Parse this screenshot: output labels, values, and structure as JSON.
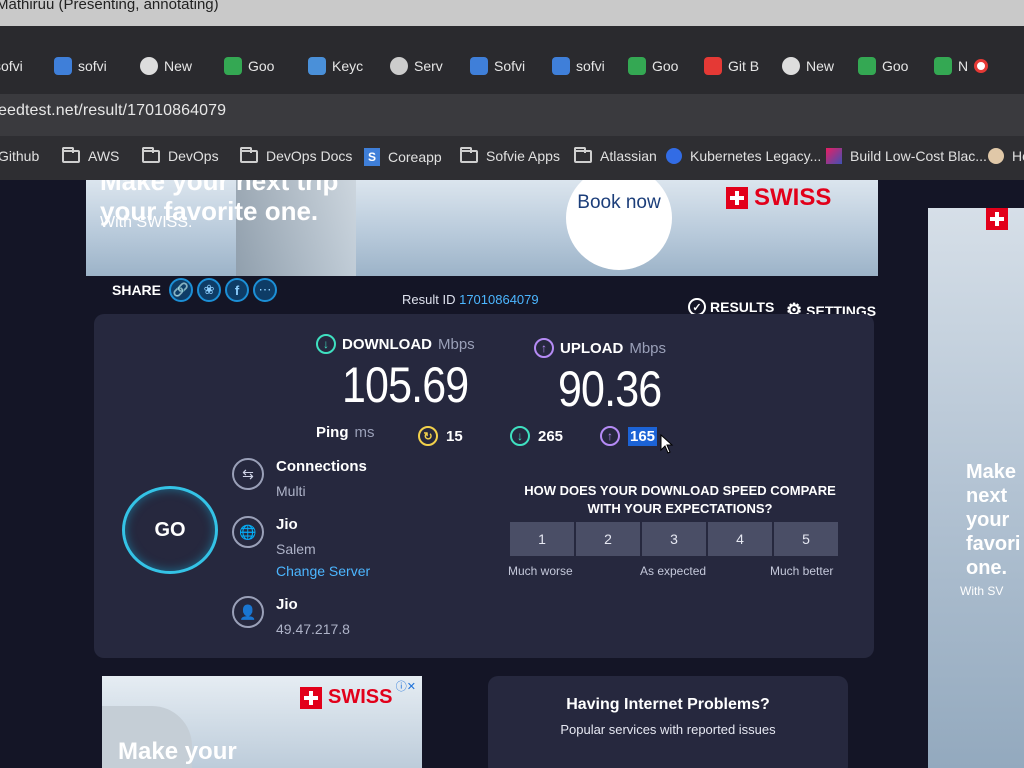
{
  "window": {
    "title": "Mathiruu (Presenting, annotating)"
  },
  "tabs": [
    {
      "label": "sofvi",
      "color": "#e8eaf0"
    },
    {
      "label": "sofvi",
      "color": "#3f7fd9"
    },
    {
      "label": "New",
      "color": "#dddddd"
    },
    {
      "label": "Goo",
      "color": "#34a853"
    },
    {
      "label": "Keyc",
      "color": "#4a90d9"
    },
    {
      "label": "Serv",
      "color": "#cccccc"
    },
    {
      "label": "Sofvi",
      "color": "#3f7fd9"
    },
    {
      "label": "sofvi",
      "color": "#3f7fd9"
    },
    {
      "label": "Goo",
      "color": "#34a853"
    },
    {
      "label": "Git B",
      "color": "#e53935"
    },
    {
      "label": "New",
      "color": "#dddddd"
    },
    {
      "label": "Goo",
      "color": "#34a853"
    },
    {
      "label": "N",
      "color": "#34a853"
    }
  ],
  "address_bar": {
    "url": "eedtest.net/result/17010864079"
  },
  "bookmarks": [
    {
      "label": "Github",
      "icon": "folder-icon"
    },
    {
      "label": "AWS",
      "icon": "folder-icon"
    },
    {
      "label": "DevOps",
      "icon": "folder-icon"
    },
    {
      "label": "DevOps Docs",
      "icon": "folder-icon"
    },
    {
      "label": "Coreapp",
      "icon": "sofvie-icon"
    },
    {
      "label": "Sofvie Apps",
      "icon": "folder-icon"
    },
    {
      "label": "Atlassian",
      "icon": "folder-icon"
    },
    {
      "label": "Kubernetes Legacy...",
      "icon": "kubernetes-icon"
    },
    {
      "label": "Build Low-Cost Blac...",
      "icon": "page-icon"
    },
    {
      "label": "Ho",
      "icon": "avatar-icon"
    }
  ],
  "top_ad": {
    "headline_1": "Make your next trip",
    "headline_2": "your favorite one.",
    "sub": "With SWISS.",
    "cta": "Book now",
    "brand": "SWISS"
  },
  "share": {
    "label": "SHARE"
  },
  "result": {
    "label": "Result ID",
    "id": "17010864079"
  },
  "nav": {
    "results": "RESULTS",
    "settings": "SETTINGS"
  },
  "download": {
    "label": "DOWNLOAD",
    "unit": "Mbps",
    "value": "105.69"
  },
  "upload": {
    "label": "UPLOAD",
    "unit": "Mbps",
    "value": "90.36"
  },
  "ping": {
    "label": "Ping",
    "unit": "ms",
    "idle": "15",
    "download": "265",
    "upload": "165"
  },
  "go": {
    "label": "GO"
  },
  "connections": {
    "title": "Connections",
    "value": "Multi"
  },
  "server": {
    "title": "Jio",
    "location": "Salem",
    "change": "Change Server"
  },
  "provider": {
    "title": "Jio",
    "ip": "49.47.217.8"
  },
  "survey": {
    "question": "HOW DOES YOUR DOWNLOAD SPEED COMPARE WITH YOUR EXPECTATIONS?",
    "options": [
      "1",
      "2",
      "3",
      "4",
      "5"
    ],
    "low": "Much worse",
    "mid": "As expected",
    "high": "Much better"
  },
  "bottom_ad": {
    "brand": "SWISS",
    "headline": "Make your"
  },
  "problems": {
    "title": "Having Internet Problems?",
    "subtitle": "Popular services with reported issues"
  },
  "right_ad": {
    "text": "Make next your favori one.",
    "sub": "With SV"
  }
}
